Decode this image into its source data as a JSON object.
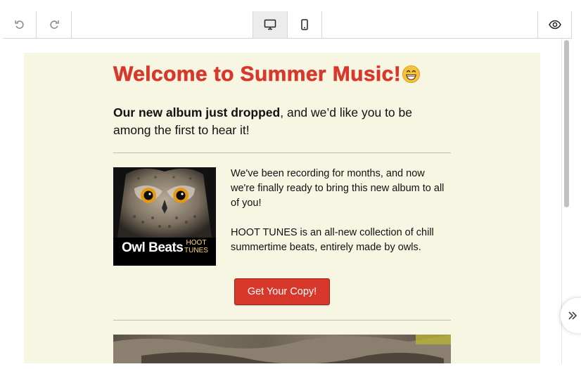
{
  "toolbar": {
    "undo_icon": "undo-icon",
    "redo_icon": "redo-icon",
    "desktop_icon": "desktop-icon",
    "mobile_icon": "mobile-icon",
    "preview_icon": "eye-icon",
    "active_view": "desktop"
  },
  "email": {
    "headline": "Welcome to Summer Music!",
    "headline_emoji": "grinning-face",
    "intro_bold": "Our new album just dropped",
    "intro_rest": ", and we’d like you to be among the first to hear it!",
    "album": {
      "title": "Owl Beats",
      "subtitle_line1": "HOOT",
      "subtitle_line2": "TUNES"
    },
    "description_p1": "We've been recording for months, and now we're finally ready to bring this new album to all of you!",
    "description_p2": "HOOT TUNES is an all-new collection of chill summertime beats, entirely made by owls.",
    "cta_label": "Get Your Copy!"
  },
  "colors": {
    "accent": "#d8382c",
    "email_background": "#f7f6e3",
    "toolbar_active": "#ececec"
  },
  "side_panel": {
    "toggle_icon": "double-chevron-right-icon"
  }
}
